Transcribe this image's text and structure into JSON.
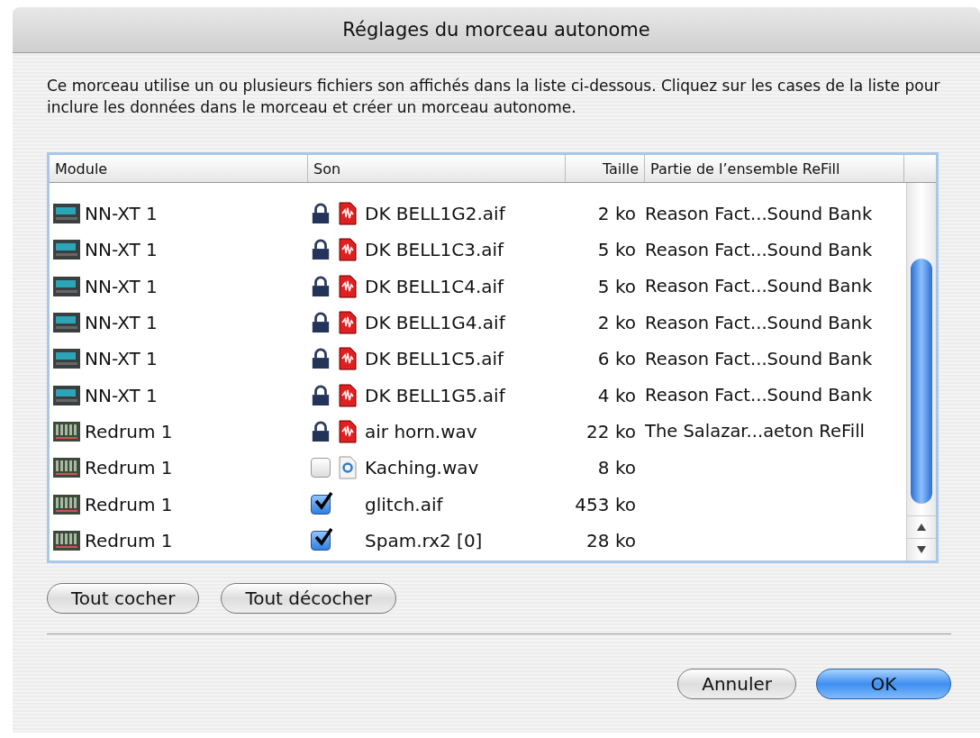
{
  "window": {
    "title": "Réglages du morceau autonome"
  },
  "description": "Ce morceau utilise un ou plusieurs fichiers son affichés dans la liste ci-dessous. Cliquez sur les cases de la liste pour inclure les données dans le morceau et créer un morceau autonome.",
  "table": {
    "columns": [
      "Module",
      "Son",
      "Taille",
      "Partie de l’ensemble ReFill"
    ],
    "rows": [
      {
        "module": "NN-XT 1",
        "module_icon": {
          "kind": "sampler"
        },
        "kind": "locked",
        "file_icon": {
          "kind": "audio"
        },
        "sound": "DK BELL1G2.aif",
        "size": "2 ko",
        "refill": "Reason Fact...Sound Bank"
      },
      {
        "module": "NN-XT 1",
        "module_icon": {
          "kind": "sampler"
        },
        "kind": "locked",
        "file_icon": {
          "kind": "audio"
        },
        "sound": "DK BELL1C3.aif",
        "size": "5 ko",
        "refill": "Reason Fact...Sound Bank"
      },
      {
        "module": "NN-XT 1",
        "module_icon": {
          "kind": "sampler"
        },
        "kind": "locked",
        "file_icon": {
          "kind": "audio"
        },
        "sound": "DK BELL1C4.aif",
        "size": "5 ko",
        "refill": "Reason Fact...Sound Bank"
      },
      {
        "module": "NN-XT 1",
        "module_icon": {
          "kind": "sampler"
        },
        "kind": "locked",
        "file_icon": {
          "kind": "audio"
        },
        "sound": "DK BELL1G4.aif",
        "size": "2 ko",
        "refill": "Reason Fact...Sound Bank"
      },
      {
        "module": "NN-XT 1",
        "module_icon": {
          "kind": "sampler"
        },
        "kind": "locked",
        "file_icon": {
          "kind": "audio"
        },
        "sound": "DK BELL1C5.aif",
        "size": "6 ko",
        "refill": "Reason Fact...Sound Bank"
      },
      {
        "module": "NN-XT 1",
        "module_icon": {
          "kind": "sampler"
        },
        "kind": "locked",
        "file_icon": {
          "kind": "audio"
        },
        "sound": "DK BELL1G5.aif",
        "size": "4 ko",
        "refill": "Reason Fact...Sound Bank"
      },
      {
        "module": "Redrum 1",
        "module_icon": {
          "kind": "drum"
        },
        "kind": "locked",
        "file_icon": {
          "kind": "audio"
        },
        "sound": "air horn.wav",
        "size": "22 ko",
        "refill": "The Salazar...aeton ReFill"
      },
      {
        "module": "Redrum 1",
        "module_icon": {
          "kind": "drum"
        },
        "kind": "checkbox",
        "checked": false,
        "file_icon": {
          "kind": "document"
        },
        "sound": "Kaching.wav",
        "size": "8 ko"
      },
      {
        "module": "Redrum 1",
        "module_icon": {
          "kind": "drum"
        },
        "kind": "checkbox",
        "checked": true,
        "sound": "glitch.aif",
        "size": "453 ko"
      },
      {
        "module": "Redrum 1",
        "module_icon": {
          "kind": "drum"
        },
        "kind": "checkbox",
        "checked": true,
        "sound": "Spam.rx2 [0]",
        "size": "28 ko"
      }
    ]
  },
  "list_buttons": [
    "Tout cocher",
    "Tout décocher"
  ],
  "buttons": [
    {
      "label": "Annuler",
      "default": false
    },
    {
      "label": "OK",
      "default": true
    }
  ]
}
